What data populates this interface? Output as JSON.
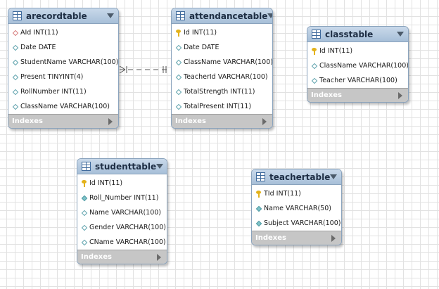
{
  "tables": [
    {
      "name": "arecordtable",
      "fields": [
        {
          "text": "AId INT(11)",
          "icon": "diamond-red"
        },
        {
          "text": "Date DATE",
          "icon": "diamond"
        },
        {
          "text": "StudentName VARCHAR(100)",
          "icon": "diamond"
        },
        {
          "text": "Present TINYINT(4)",
          "icon": "diamond"
        },
        {
          "text": "RollNumber INT(11)",
          "icon": "diamond"
        },
        {
          "text": "ClassName VARCHAR(100)",
          "icon": "diamond"
        }
      ],
      "indexes_label": "Indexes"
    },
    {
      "name": "attendancetable",
      "fields": [
        {
          "text": "Id INT(11)",
          "icon": "key"
        },
        {
          "text": "Date DATE",
          "icon": "diamond"
        },
        {
          "text": "ClassName VARCHAR(100)",
          "icon": "diamond"
        },
        {
          "text": "TeacherId VARCHAR(100)",
          "icon": "diamond"
        },
        {
          "text": "TotalStrength INT(11)",
          "icon": "diamond"
        },
        {
          "text": "TotalPresent INT(11)",
          "icon": "diamond"
        }
      ],
      "indexes_label": "Indexes"
    },
    {
      "name": "classtable",
      "fields": [
        {
          "text": "Id INT(11)",
          "icon": "key"
        },
        {
          "text": "ClassName VARCHAR(100)",
          "icon": "diamond"
        },
        {
          "text": "Teacher VARCHAR(100)",
          "icon": "diamond"
        }
      ],
      "indexes_label": "Indexes"
    },
    {
      "name": "studenttable",
      "fields": [
        {
          "text": "Id INT(11)",
          "icon": "key"
        },
        {
          "text": "Roll_Number INT(11)",
          "icon": "diamond-teal"
        },
        {
          "text": "Name VARCHAR(100)",
          "icon": "diamond"
        },
        {
          "text": "Gender VARCHAR(100)",
          "icon": "diamond"
        },
        {
          "text": "CName VARCHAR(100)",
          "icon": "diamond"
        }
      ],
      "indexes_label": "Indexes"
    },
    {
      "name": "teachertable",
      "fields": [
        {
          "text": "TId INT(11)",
          "icon": "key"
        },
        {
          "text": "Name VARCHAR(50)",
          "icon": "diamond-teal"
        },
        {
          "text": "Subject VARCHAR(100)",
          "icon": "diamond-teal"
        }
      ],
      "indexes_label": "Indexes"
    }
  ],
  "relationship": {
    "from": "arecordtable",
    "to": "attendancetable",
    "style": "dashed",
    "from_end": "many",
    "to_end": "one"
  },
  "colors": {
    "header_top": "#c9d9ea",
    "header_bottom": "#a7bfd8",
    "border": "#8aa3bd",
    "indexes_bg": "#c6c6c6",
    "key": "#e3b21b"
  }
}
